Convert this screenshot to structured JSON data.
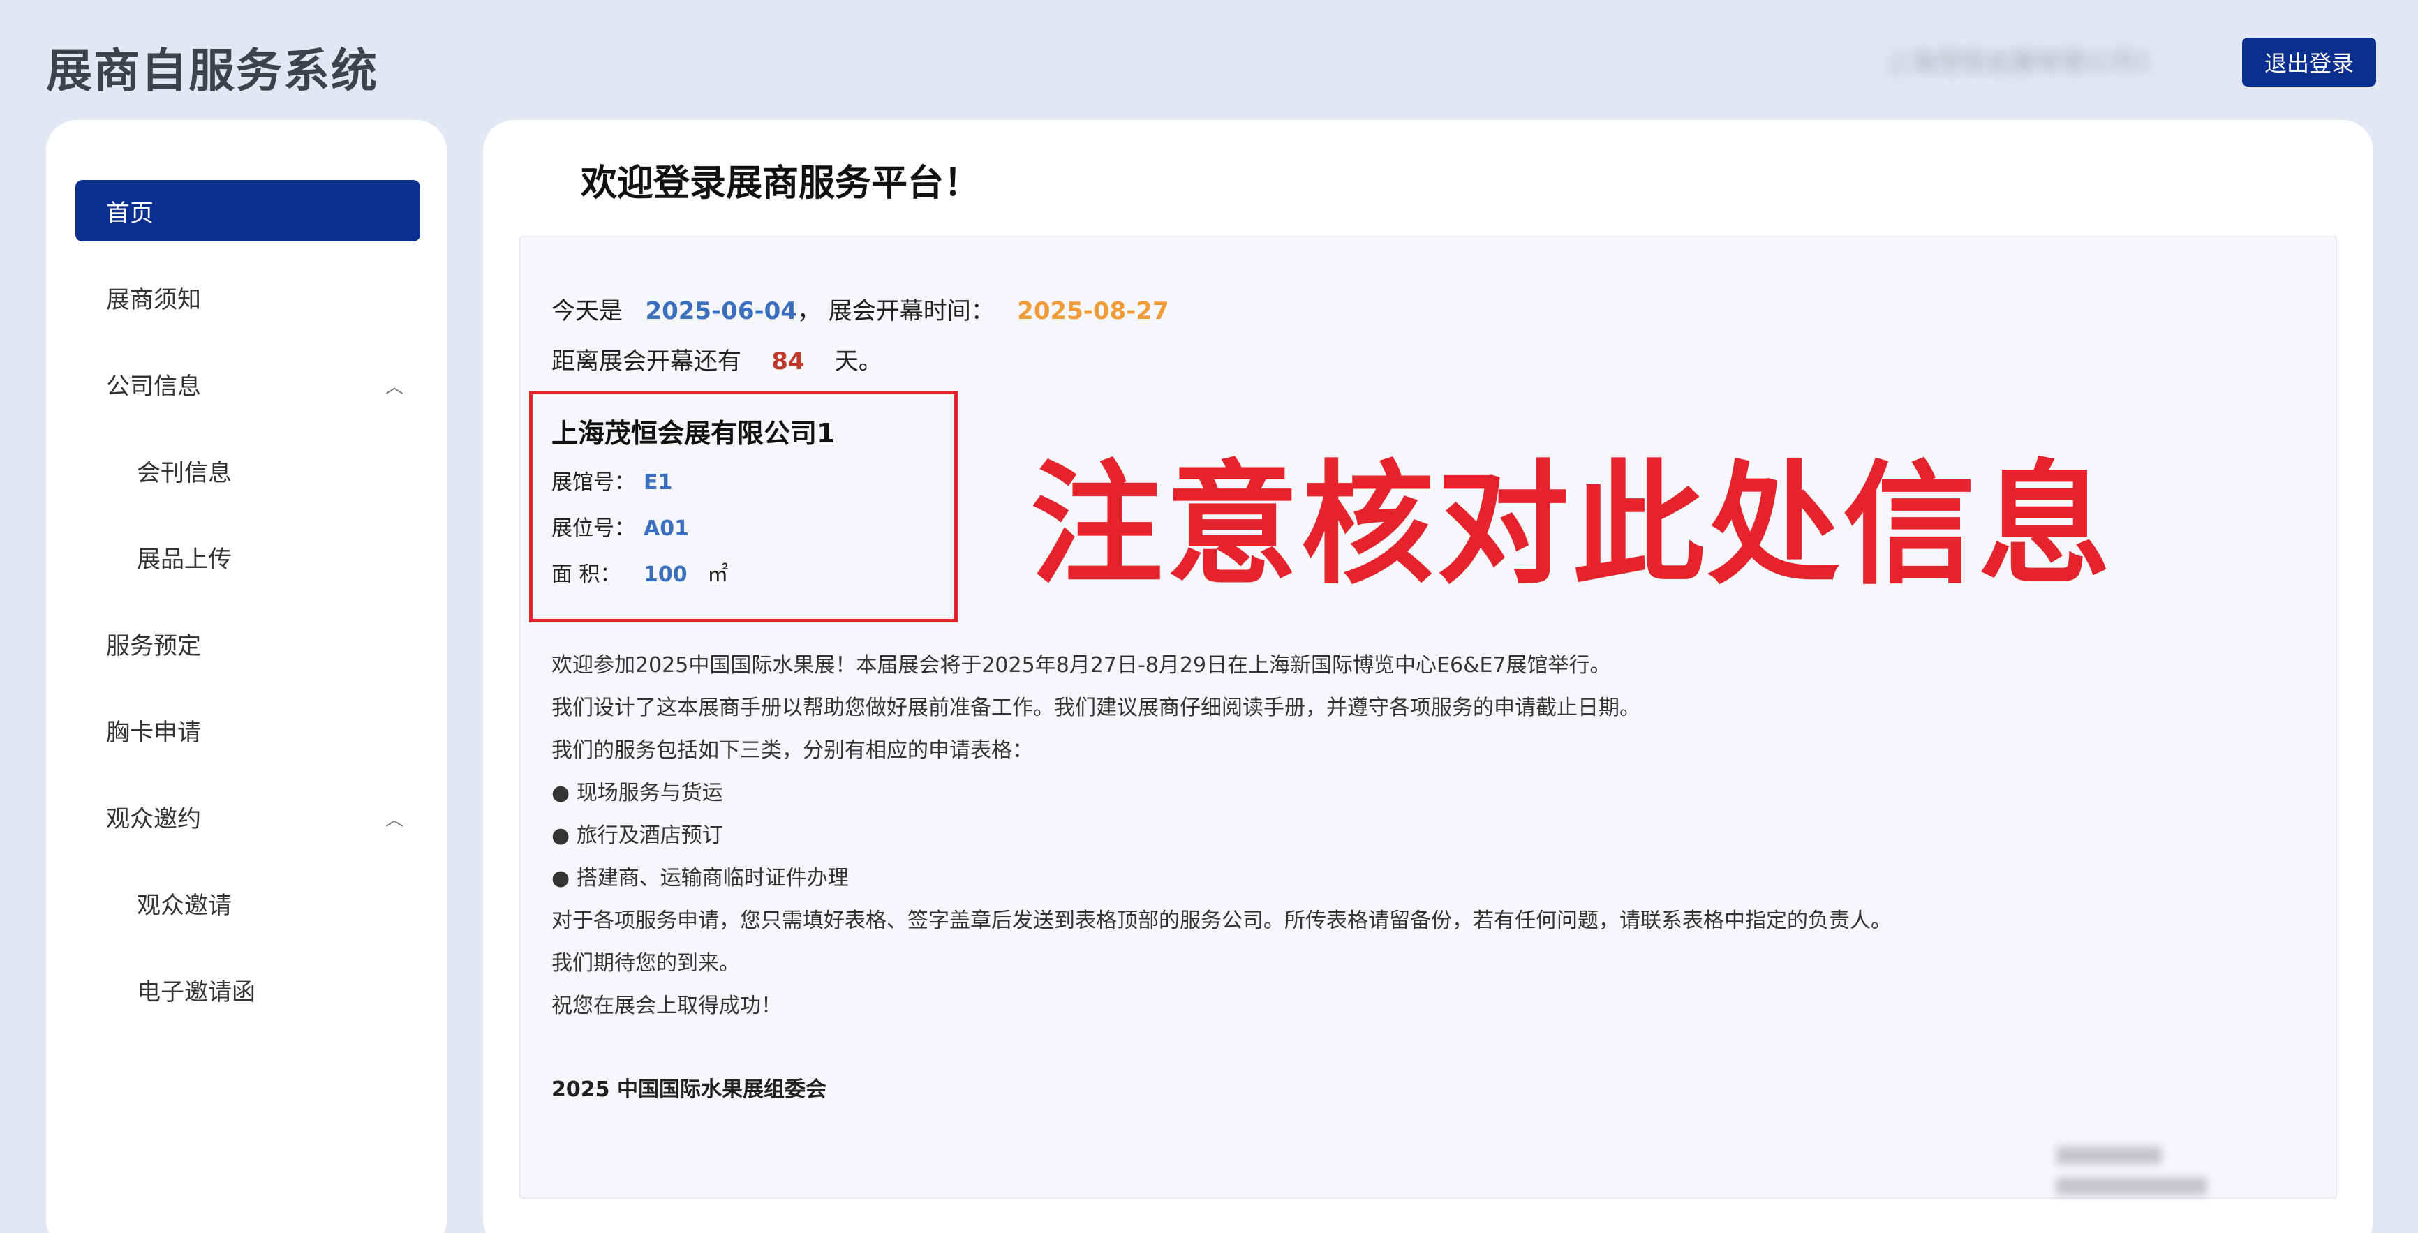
{
  "header": {
    "app_title": "展商自服务系统",
    "user_name": "上海茂恒会展有限公司1",
    "logout_label": "退出登录"
  },
  "sidebar": {
    "items": [
      {
        "label": "首页",
        "active": true
      },
      {
        "label": "展商须知"
      },
      {
        "label": "公司信息",
        "expandable": true
      },
      {
        "label": "会刊信息",
        "sub": true
      },
      {
        "label": "展品上传",
        "sub": true
      },
      {
        "label": "服务预定"
      },
      {
        "label": "胸卡申请"
      },
      {
        "label": "观众邀约",
        "expandable": true
      },
      {
        "label": "观众邀请",
        "sub": true
      },
      {
        "label": "电子邀请函",
        "sub": true
      }
    ],
    "chevron_glyph": "︿"
  },
  "main": {
    "welcome": "欢迎登录展商服务平台！",
    "today_prefix": "今天是",
    "today_date": "2025-06-04",
    "open_prefix": "，  展会开幕时间：",
    "open_date": "2025-08-27",
    "countdown_prefix": "距离展会开幕还有",
    "countdown_days": "84",
    "countdown_suffix": "天。",
    "company": {
      "name": "上海茂恒会展有限公司1",
      "hall_label": "展馆号：",
      "hall_value": "E1",
      "booth_label": "展位号：",
      "booth_value": "A01",
      "area_label": "面    积：",
      "area_value": "100",
      "area_unit": "㎡"
    },
    "warning": "注意核对此处信息",
    "paragraphs": [
      "欢迎参加2025中国国际水果展！本届展会将于2025年8月27日-8月29日在上海新国际博览中心E6&E7展馆举行。",
      "我们设计了这本展商手册以帮助您做好展前准备工作。我们建议展商仔细阅读手册，并遵守各项服务的申请截止日期。",
      "我们的服务包括如下三类，分别有相应的申请表格：",
      "● 现场服务与货运",
      "● 旅行及酒店预订",
      "● 搭建商、运输商临时证件办理",
      "对于各项服务申请，您只需填好表格、签字盖章后发送到表格顶部的服务公司。所传表格请留备份，若有任何问题，请联系表格中指定的负责人。",
      "我们期待您的到来。",
      "祝您在展会上取得成功！"
    ],
    "signature": "2025 中国国际水果展组委会"
  }
}
